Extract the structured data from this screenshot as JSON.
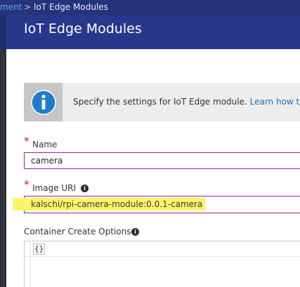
{
  "breadcrumb": {
    "link": "ment",
    "separator": ">",
    "current": "IoT Edge Modules"
  },
  "blade": {
    "title": "IoT Edge Modules"
  },
  "info_banner": {
    "icon": "info-icon",
    "text": "Specify the settings for IoT Edge module. ",
    "link": "Learn how to c"
  },
  "form": {
    "name": {
      "required_mark": "*",
      "label": "Name",
      "value": "camera"
    },
    "image_uri": {
      "required_mark": "*",
      "label": "Image URI",
      "info_glyph": "i",
      "value": "kalschi/rpi-camera-module:0.0.1-camera"
    },
    "container_create_options": {
      "label": "Container Create Options",
      "info_glyph": "i",
      "value": "{}"
    }
  },
  "colors": {
    "header_bg": "#27378b",
    "crumb_link": "#5fa8f0",
    "input_border": "#8e2b8c",
    "required": "#d81c1c",
    "highlight": "#fbf56a",
    "link": "#1a6fbf"
  }
}
